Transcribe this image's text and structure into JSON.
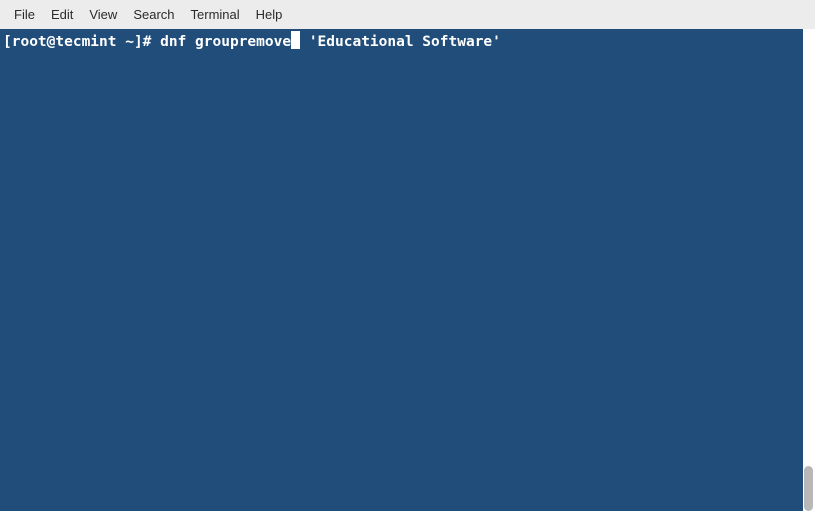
{
  "menubar": {
    "items": [
      {
        "label": "File"
      },
      {
        "label": "Edit"
      },
      {
        "label": "View"
      },
      {
        "label": "Search"
      },
      {
        "label": "Terminal"
      },
      {
        "label": "Help"
      }
    ]
  },
  "terminal": {
    "prompt_part1": "[root@tecmint ~]# dnf groupremove",
    "prompt_part2": " 'Educational Software'"
  }
}
